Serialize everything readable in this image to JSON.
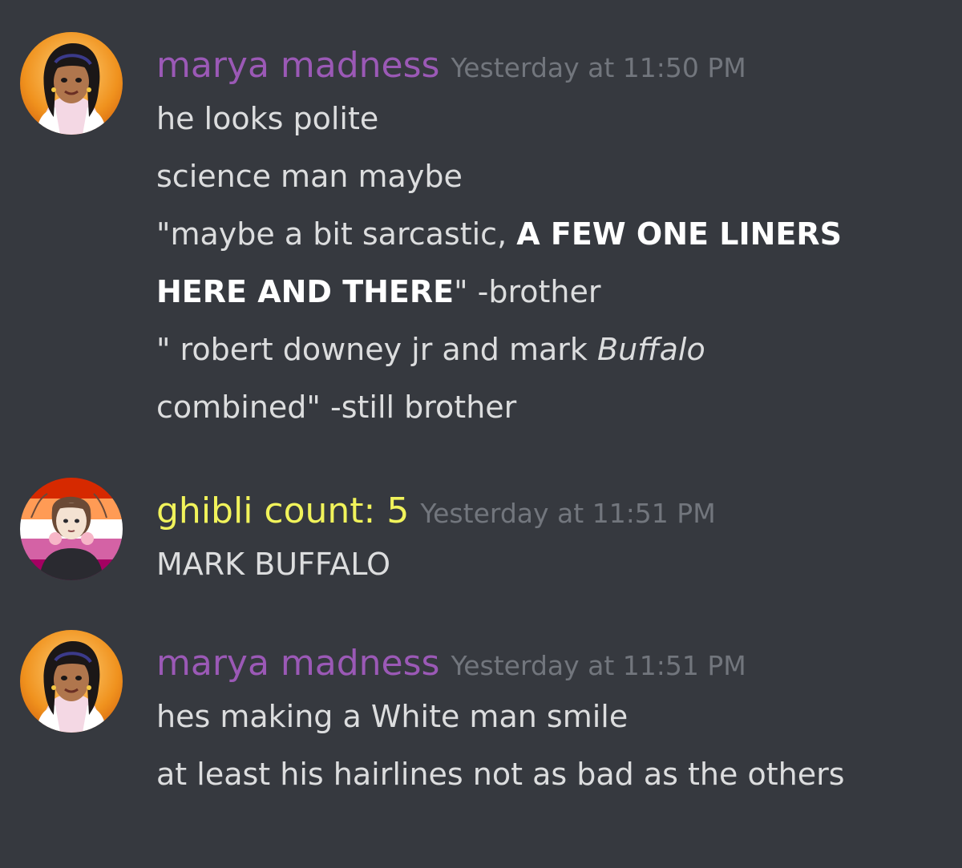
{
  "colors": {
    "background": "#36393f",
    "text": "#dcddde",
    "timestamp": "#72767d",
    "marya_name": "#9b59b6",
    "ghibli_name": "#f1f35b"
  },
  "messages": [
    {
      "author": "marya madness",
      "avatar_icon": "marya-avatar-icon",
      "timestamp": "Yesterday at 11:50 PM",
      "lines": {
        "l1": "he looks polite",
        "l2": "science man maybe",
        "l3a": "\"maybe a bit sarcastic, ",
        "l3b": "A FEW ONE LINERS",
        "l4a": "HERE AND THERE",
        "l4b": "\" -brother",
        "l5a": "\" robert downey jr and mark ",
        "l5b": "Buffalo",
        "l6": "combined\" -still brother"
      }
    },
    {
      "author": "ghibli count: 5",
      "avatar_icon": "ghibli-avatar-icon",
      "timestamp": "Yesterday at 11:51 PM",
      "lines": {
        "l1": "MARK BUFFALO"
      }
    },
    {
      "author": "marya madness",
      "avatar_icon": "marya-avatar-icon",
      "timestamp": "Yesterday at 11:51 PM",
      "lines": {
        "l1": "hes making a White man smile",
        "l2": "at least his hairlines not as bad as the others"
      }
    }
  ]
}
